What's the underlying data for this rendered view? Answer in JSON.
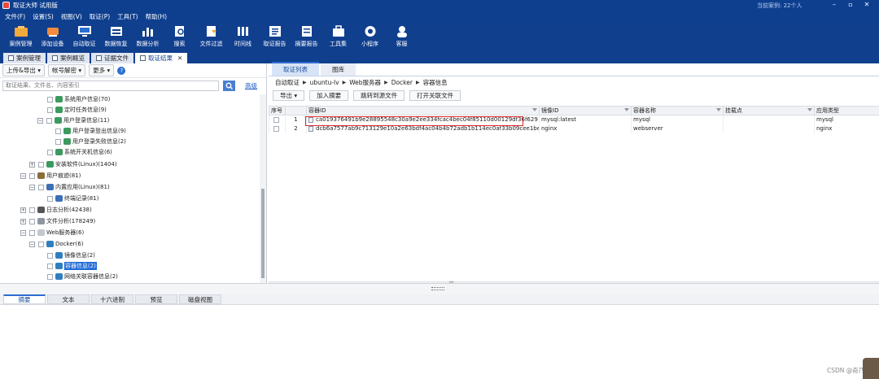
{
  "window": {
    "title": "取证大师 试用版",
    "case_text": "当前案例: 22个人"
  },
  "menu": [
    "文件(F)",
    "设置(S)",
    "视图(V)",
    "取证(P)",
    "工具(T)",
    "帮助(H)"
  ],
  "toolbar": [
    {
      "label": "案例管理",
      "icon": "case-icon",
      "color": "#f2a93b"
    },
    {
      "label": "添加设备",
      "icon": "device-icon",
      "color": "#f28b3b"
    },
    {
      "label": "自动取证",
      "icon": "auto-icon",
      "color": "#ffffff"
    },
    {
      "label": "数据恢复",
      "icon": "recover-icon",
      "color": "#ffffff"
    },
    {
      "label": "数据分析",
      "icon": "analysis-icon",
      "color": "#ffffff"
    },
    {
      "label": "搜索",
      "icon": "search-icon",
      "color": "#ffffff"
    },
    {
      "label": "文件过滤",
      "icon": "filter-icon",
      "color": "#ffffff"
    },
    {
      "label": "时间线",
      "icon": "timeline-icon",
      "color": "#ffffff"
    },
    {
      "label": "取证报告",
      "icon": "report-icon",
      "color": "#ffffff"
    },
    {
      "label": "摘要报告",
      "icon": "summary-icon",
      "color": "#ffffff"
    },
    {
      "label": "工具集",
      "icon": "tools-icon",
      "color": "#ffffff"
    },
    {
      "label": "小程序",
      "icon": "miniapp-icon",
      "color": "#ffffff"
    },
    {
      "label": "客服",
      "icon": "service-icon",
      "color": "#ffffff"
    }
  ],
  "doc_tabs": [
    "案例管理",
    "案例概览",
    "证据文件",
    "取证结果"
  ],
  "left": {
    "toolbar": [
      "上传&导出",
      "帐号解密",
      "更多"
    ],
    "search_placeholder": "取证结果、文件名、内容索引",
    "advanced": "高级",
    "tree": [
      {
        "label": "系统用户信息(70)"
      },
      {
        "label": "定时任务信息(9)"
      },
      {
        "label": "用户登录信息(11)"
      },
      {
        "label": "用户登录登出信息(9)"
      },
      {
        "label": "用户登录失败信息(2)"
      },
      {
        "label": "系统开关机信息(6)"
      },
      {
        "label": "安装软件(Linux)(1404)"
      },
      {
        "label": "用户痕迹(81)"
      },
      {
        "label": "内置应用(Linux)(81)"
      },
      {
        "label": "终端记录(81)"
      },
      {
        "label": "日志分析(42438)"
      },
      {
        "label": "文件分析(178249)"
      },
      {
        "label": "Web服务器(6)"
      },
      {
        "label": "Docker(6)"
      },
      {
        "label": "镜像信息(2)"
      },
      {
        "label": "容器信息(2)"
      },
      {
        "label": "网络关联容器信息(2)"
      }
    ]
  },
  "right": {
    "tabs": [
      "取证列表",
      "图库"
    ],
    "breadcrumb": [
      "自动取证",
      "ubuntu-lv",
      "Web服务器",
      "Docker",
      "容器信息"
    ],
    "actions": [
      "导出",
      "加入摘要",
      "跳转到源文件",
      "打开关联文件"
    ],
    "columns": [
      "序号",
      "容器ID",
      "镜像ID",
      "容器名称",
      "挂载点",
      "应用类型"
    ],
    "rows": [
      {
        "no": "1",
        "id": "ca019376491b9e28895548c30a9e2ee334fcac4bec04f85110d00129df36f629",
        "image": "mysql:latest",
        "name": "mysql",
        "mount": "",
        "type": "mysql"
      },
      {
        "no": "2",
        "id": "dcb6a7577ab9c713129e10a2e63bdf4ac04b4b72adb1b114ec0af33b09cee1be",
        "image": "nginx",
        "name": "webserver",
        "mount": "",
        "type": "nginx"
      }
    ],
    "scroll_mid": "III"
  },
  "bottom_tabs": [
    "摘要",
    "文本",
    "十六进制",
    "预览",
    "磁盘视图"
  ],
  "watermark": "CSDN @奇乃正",
  "colors": {
    "titlebar": "#0e3f8f",
    "highlight": "#e0252a",
    "selection": "#1f69d6"
  }
}
